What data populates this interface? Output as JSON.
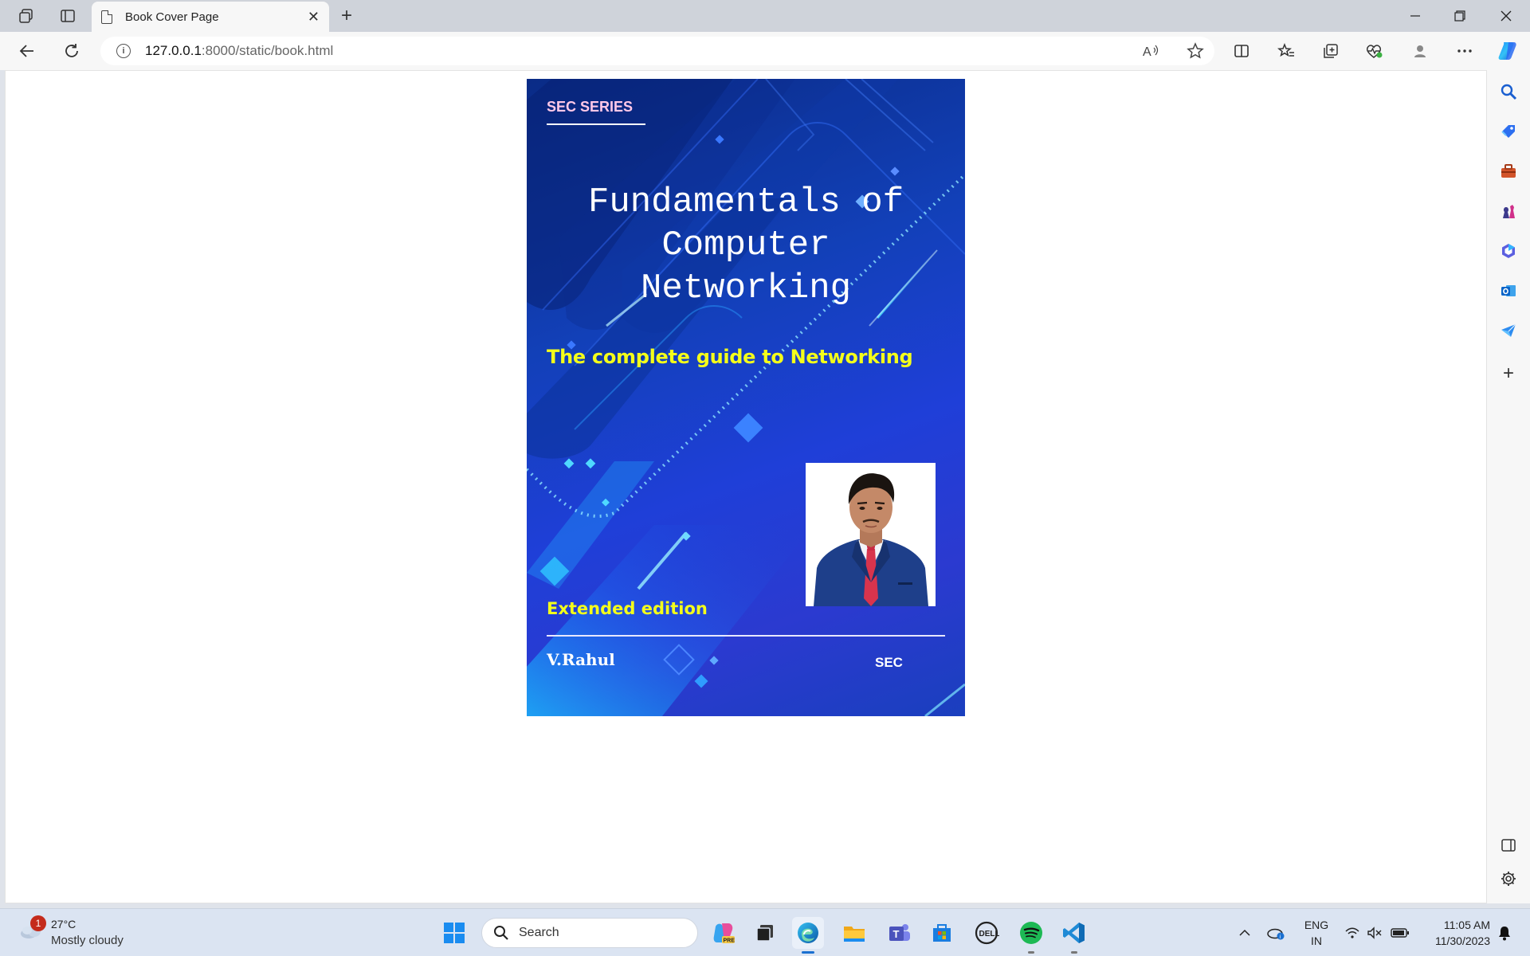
{
  "browser": {
    "tab_title": "Book Cover Page",
    "url_host": "127.0.0.1",
    "url_path": ":8000/static/book.html"
  },
  "cover": {
    "series": "SEC SERIES",
    "title_lines": [
      "Fundamentals of",
      "Computer",
      "Networking"
    ],
    "subtitle": "The complete guide to Networking",
    "edition": "Extended edition",
    "author": "V.Rahul",
    "publisher": "SEC",
    "colors": {
      "series": "#ffc8e8",
      "subtitle": "#f4ff1a",
      "edition": "#f4ff1a",
      "background": "#1a3fc8"
    }
  },
  "taskbar": {
    "weather_badge": "1",
    "weather_temp": "27°C",
    "weather_condition": "Mostly cloudy",
    "search_label": "Search",
    "lang_line1": "ENG",
    "lang_line2": "IN",
    "time": "11:05 AM",
    "date": "11/30/2023"
  },
  "icons": {
    "tabstrip": [
      "workspaces-icon",
      "tab-actions-icon"
    ],
    "toolbar": [
      "back-icon",
      "refresh-icon",
      "read-aloud-icon",
      "favorite-star-icon",
      "split-screen-icon",
      "favorites-icon",
      "collections-icon",
      "browser-essentials-icon",
      "profile-icon",
      "more-icon",
      "copilot-icon"
    ],
    "sidebar": [
      "search-icon",
      "shopping-icon",
      "tools-icon",
      "games-icon",
      "microsoft-365-icon",
      "outlook-icon",
      "send-icon",
      "add-icon",
      "sidebar-toggle-icon",
      "settings-icon"
    ]
  }
}
